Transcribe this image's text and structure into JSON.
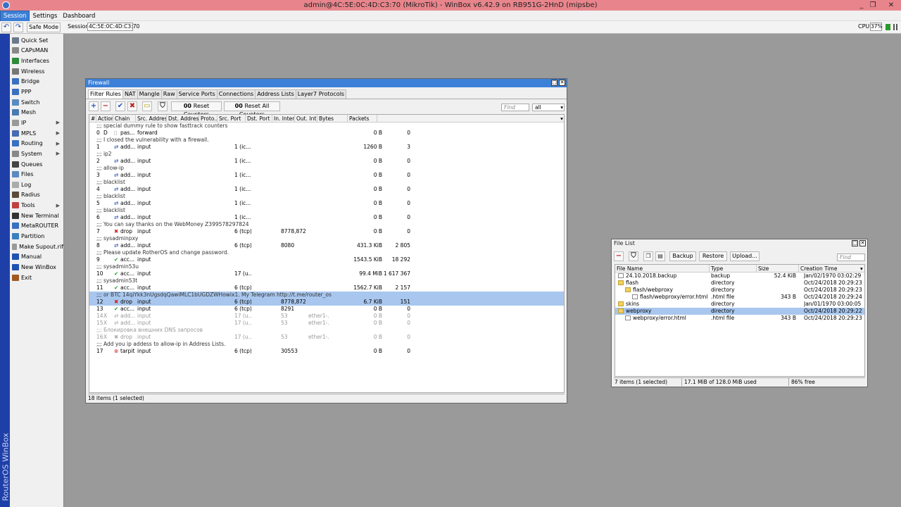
{
  "window_title": "admin@4C:5E:0C:4D:C3:70 (MikroTik) - WinBox v6.42.9 on RB951G-2HnD (mipsbe)",
  "window_controls": [
    "_",
    "❐",
    "✕"
  ],
  "menu": [
    "Session",
    "Settings",
    "Dashboard"
  ],
  "toolbar": {
    "undo": "↶",
    "redo": "↷",
    "safe_mode": "Safe Mode",
    "session_label": "Session:",
    "session_value": "4C:5E:0C:4D:C3:70",
    "cpu_label": "CPU:",
    "cpu_value": "37%"
  },
  "brand_vertical": "RouterOS WinBox",
  "sidebar": [
    {
      "label": "Quick Set",
      "icon": "quickset-icon",
      "color": "#6a7a8a",
      "sub": false
    },
    {
      "label": "CAPsMAN",
      "icon": "capsman-icon",
      "color": "#888",
      "sub": false
    },
    {
      "label": "Interfaces",
      "icon": "interfaces-icon",
      "color": "#2f8a3a",
      "sub": false
    },
    {
      "label": "Wireless",
      "icon": "wireless-icon",
      "color": "#777",
      "sub": false
    },
    {
      "label": "Bridge",
      "icon": "bridge-icon",
      "color": "#3a70c0",
      "sub": false
    },
    {
      "label": "PPP",
      "icon": "ppp-icon",
      "color": "#3a70c0",
      "sub": false
    },
    {
      "label": "Switch",
      "icon": "switch-icon",
      "color": "#5a8ac0",
      "sub": false
    },
    {
      "label": "Mesh",
      "icon": "mesh-icon",
      "color": "#4a7ab0",
      "sub": false
    },
    {
      "label": "IP",
      "icon": "ip-icon",
      "color": "#999",
      "sub": true
    },
    {
      "label": "MPLS",
      "icon": "mpls-icon",
      "color": "#4a6ab0",
      "sub": true
    },
    {
      "label": "Routing",
      "icon": "routing-icon",
      "color": "#3a70c0",
      "sub": true
    },
    {
      "label": "System",
      "icon": "system-icon",
      "color": "#888",
      "sub": true
    },
    {
      "label": "Queues",
      "icon": "queues-icon",
      "color": "#444",
      "sub": false
    },
    {
      "label": "Files",
      "icon": "files-icon",
      "color": "#5a8ac0",
      "sub": false
    },
    {
      "label": "Log",
      "icon": "log-icon",
      "color": "#aaa",
      "sub": false
    },
    {
      "label": "Radius",
      "icon": "radius-icon",
      "color": "#5a4a3a",
      "sub": false
    },
    {
      "label": "Tools",
      "icon": "tools-icon",
      "color": "#c04040",
      "sub": true
    },
    {
      "label": "New Terminal",
      "icon": "terminal-icon",
      "color": "#333",
      "sub": false
    },
    {
      "label": "MetaROUTER",
      "icon": "metarouter-icon",
      "color": "#3a70c0",
      "sub": false
    },
    {
      "label": "Partition",
      "icon": "partition-icon",
      "color": "#3a80c0",
      "sub": false
    },
    {
      "label": "Make Supout.rif",
      "icon": "supout-icon",
      "color": "#999",
      "sub": false
    },
    {
      "label": "Manual",
      "icon": "manual-icon",
      "color": "#2050b0",
      "sub": false
    },
    {
      "label": "New WinBox",
      "icon": "winbox-icon",
      "color": "#2050b0",
      "sub": false
    },
    {
      "label": "Exit",
      "icon": "exit-icon",
      "color": "#a05a20",
      "sub": false
    }
  ],
  "firewall": {
    "title": "Firewall",
    "tabs": [
      "Filter Rules",
      "NAT",
      "Mangle",
      "Raw",
      "Service Ports",
      "Connections",
      "Address Lists",
      "Layer7 Protocols"
    ],
    "reset_counters": "Reset Counters",
    "reset_all_counters": "Reset All Counters",
    "find_placeholder": "Find",
    "filter_value": "all",
    "columns": [
      "#",
      "Action",
      "Chain",
      "Src. Address",
      "Dst. Address",
      "Proto...",
      "Src. Port",
      "Dst. Port",
      "In. Inter...",
      "Out. Int...",
      "Bytes",
      "Packets"
    ],
    "rows": [
      {
        "type": "comment",
        "text": ";;; special dummy rule to show fasttrack counters"
      },
      {
        "type": "rule",
        "num": "0",
        "flag": "D",
        "icon": "pass",
        "action": "pas...",
        "chain": "forward",
        "proto": "",
        "dport": "",
        "iin": "",
        "bytes": "0 B",
        "packets": "0"
      },
      {
        "type": "comment",
        "text": ";;; I closed the vulnerability with a firewall."
      },
      {
        "type": "rule",
        "num": "1",
        "flag": "",
        "icon": "add",
        "action": "add...",
        "chain": "input",
        "proto": "1 (ic...",
        "dport": "",
        "iin": "",
        "bytes": "1260 B",
        "packets": "3"
      },
      {
        "type": "comment",
        "text": ";;; ip2"
      },
      {
        "type": "rule",
        "num": "2",
        "flag": "",
        "icon": "add",
        "action": "add...",
        "chain": "input",
        "proto": "1 (ic...",
        "dport": "",
        "iin": "",
        "bytes": "0 B",
        "packets": "0"
      },
      {
        "type": "comment",
        "text": ";;; allow-ip"
      },
      {
        "type": "rule",
        "num": "3",
        "flag": "",
        "icon": "add",
        "action": "add...",
        "chain": "input",
        "proto": "1 (ic...",
        "dport": "",
        "iin": "",
        "bytes": "0 B",
        "packets": "0"
      },
      {
        "type": "comment",
        "text": ";;; blacklist"
      },
      {
        "type": "rule",
        "num": "4",
        "flag": "",
        "icon": "add",
        "action": "add...",
        "chain": "input",
        "proto": "1 (ic...",
        "dport": "",
        "iin": "",
        "bytes": "0 B",
        "packets": "0"
      },
      {
        "type": "comment",
        "text": ";;; blacklist"
      },
      {
        "type": "rule",
        "num": "5",
        "flag": "",
        "icon": "add",
        "action": "add...",
        "chain": "input",
        "proto": "1 (ic...",
        "dport": "",
        "iin": "",
        "bytes": "0 B",
        "packets": "0"
      },
      {
        "type": "comment",
        "text": ";;; blacklist"
      },
      {
        "type": "rule",
        "num": "6",
        "flag": "",
        "icon": "add",
        "action": "add...",
        "chain": "input",
        "proto": "1 (ic...",
        "dport": "",
        "iin": "",
        "bytes": "0 B",
        "packets": "0"
      },
      {
        "type": "comment",
        "text": ";;; You can say thanks on the WebMoney Z399578297824"
      },
      {
        "type": "rule",
        "num": "7",
        "flag": "",
        "icon": "drop",
        "action": "drop",
        "chain": "input",
        "proto": "6 (tcp)",
        "dport": "8778,872...",
        "iin": "",
        "bytes": "0 B",
        "packets": "0"
      },
      {
        "type": "comment",
        "text": ";;; sysadminpxy"
      },
      {
        "type": "rule",
        "num": "8",
        "flag": "",
        "icon": "add",
        "action": "add...",
        "chain": "input",
        "proto": "6 (tcp)",
        "dport": "8080",
        "iin": "",
        "bytes": "431.3 KiB",
        "packets": "2 805"
      },
      {
        "type": "comment",
        "text": ";;; Please update RotherOS and change password."
      },
      {
        "type": "rule",
        "num": "9",
        "flag": "",
        "icon": "accept",
        "action": "acc...",
        "chain": "input",
        "proto": "",
        "dport": "",
        "iin": "",
        "bytes": "1543.5 KiB",
        "packets": "18 292"
      },
      {
        "type": "comment",
        "text": ";;; sysadmin53u"
      },
      {
        "type": "rule",
        "num": "10",
        "flag": "",
        "icon": "accept",
        "action": "acc...",
        "chain": "input",
        "proto": "17 (u...",
        "dport": "",
        "iin": "",
        "bytes": "99.4 MiB",
        "packets": "1 617 367"
      },
      {
        "type": "comment",
        "text": ";;; sysadmin53t"
      },
      {
        "type": "rule",
        "num": "11",
        "flag": "",
        "icon": "accept",
        "action": "acc...",
        "chain": "input",
        "proto": "6 (tcp)",
        "dport": "",
        "iin": "",
        "bytes": "1562.7 KiB",
        "packets": "2 157"
      },
      {
        "type": "comment",
        "sel": true,
        "text": ";;; or BTC 14qiYkk3nUgsdqQawiMLC1bUGDZWHowix1. My Telegram http://t.me/router_os"
      },
      {
        "type": "rule",
        "sel": true,
        "num": "12",
        "flag": "",
        "icon": "drop",
        "action": "drop",
        "chain": "input",
        "proto": "6 (tcp)",
        "dport": "8778,872...",
        "iin": "",
        "bytes": "6.7 KiB",
        "packets": "151"
      },
      {
        "type": "rule",
        "num": "13",
        "flag": "",
        "icon": "accept",
        "action": "acc...",
        "chain": "input",
        "proto": "6 (tcp)",
        "dport": "8291",
        "iin": "",
        "bytes": "0 B",
        "packets": "0"
      },
      {
        "type": "rule",
        "dis": true,
        "num": "14",
        "flag": "X",
        "icon": "add",
        "action": "add...",
        "chain": "input",
        "proto": "17 (u...",
        "dport": "53",
        "iin": "ether1-...",
        "bytes": "0 B",
        "packets": "0"
      },
      {
        "type": "rule",
        "dis": true,
        "num": "15",
        "flag": "X",
        "icon": "add",
        "action": "add...",
        "chain": "input",
        "proto": "17 (u...",
        "dport": "53",
        "iin": "ether1-...",
        "bytes": "0 B",
        "packets": "0"
      },
      {
        "type": "comment",
        "dis": true,
        "text": ";;; Блокировка внешних DNS запросов"
      },
      {
        "type": "rule",
        "dis": true,
        "num": "16",
        "flag": "X",
        "icon": "drop",
        "action": "drop",
        "chain": "input",
        "proto": "17 (u...",
        "dport": "53",
        "iin": "ether1-...",
        "bytes": "0 B",
        "packets": "0"
      },
      {
        "type": "comment",
        "text": ";;; Add you ip addess to allow-ip in Address Lists."
      },
      {
        "type": "rule",
        "num": "17",
        "flag": "",
        "icon": "tarpit",
        "action": "tarpit",
        "chain": "input",
        "proto": "6 (tcp)",
        "dport": "30553",
        "iin": "",
        "bytes": "0 B",
        "packets": "0"
      }
    ],
    "status": "18 items (1 selected)"
  },
  "filelist": {
    "title": "File List",
    "backup": "Backup",
    "restore": "Restore",
    "upload": "Upload...",
    "find_placeholder": "Find",
    "columns": [
      "File Name",
      "Type",
      "Size",
      "Creation Time"
    ],
    "rows": [
      {
        "indent": 0,
        "icon": "file",
        "name": "24.10.2018.backup",
        "type": "backup",
        "size": "52.4 KiB",
        "time": "Jan/02/1970 03:02:29"
      },
      {
        "indent": 0,
        "icon": "folder",
        "name": "flash",
        "type": "directory",
        "size": "",
        "time": "Oct/24/2018 20:29:23"
      },
      {
        "indent": 1,
        "icon": "folder",
        "name": "flash/webproxy",
        "type": "directory",
        "size": "",
        "time": "Oct/24/2018 20:29:23"
      },
      {
        "indent": 2,
        "icon": "file",
        "name": "flash/webproxy/error.html",
        "type": ".html file",
        "size": "343 B",
        "time": "Oct/24/2018 20:29:24"
      },
      {
        "indent": 0,
        "icon": "folder",
        "name": "skins",
        "type": "directory",
        "size": "",
        "time": "Jan/01/1970 03:00:05"
      },
      {
        "indent": 0,
        "icon": "folder",
        "name": "webproxy",
        "type": "directory",
        "size": "",
        "time": "Oct/24/2018 20:29:22",
        "sel": true
      },
      {
        "indent": 1,
        "icon": "file",
        "name": "webproxy/error.html",
        "type": ".html file",
        "size": "343 B",
        "time": "Oct/24/2018 20:29:23"
      }
    ],
    "status_items": "7 items (1 selected)",
    "status_used": "17.1 MiB of 128.0 MiB used",
    "status_free": "86% free"
  }
}
